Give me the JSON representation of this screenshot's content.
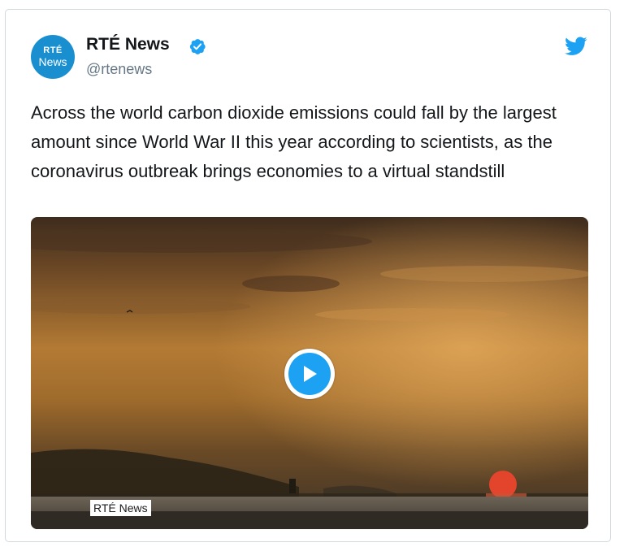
{
  "author": {
    "name": "RTÉ News",
    "handle": "@rtenews",
    "avatar_line1": "RTÉ",
    "avatar_line2": "News",
    "verified": true
  },
  "tweet": {
    "text": "Across the world carbon dioxide emissions could fall by the largest amount since World War II this year according to scientists, as the coronavirus outbreak brings economies to a virtual standstill"
  },
  "media": {
    "type": "video",
    "watermark": "RTÉ News",
    "play_icon": "play-icon"
  },
  "icons": {
    "brand": "twitter-bird-icon",
    "verified": "verified-badge-icon"
  },
  "colors": {
    "twitter_blue": "#1da1f2",
    "avatar_blue": "#1a8fd0",
    "handle_gray": "#657786",
    "text_dark": "#14171a"
  }
}
